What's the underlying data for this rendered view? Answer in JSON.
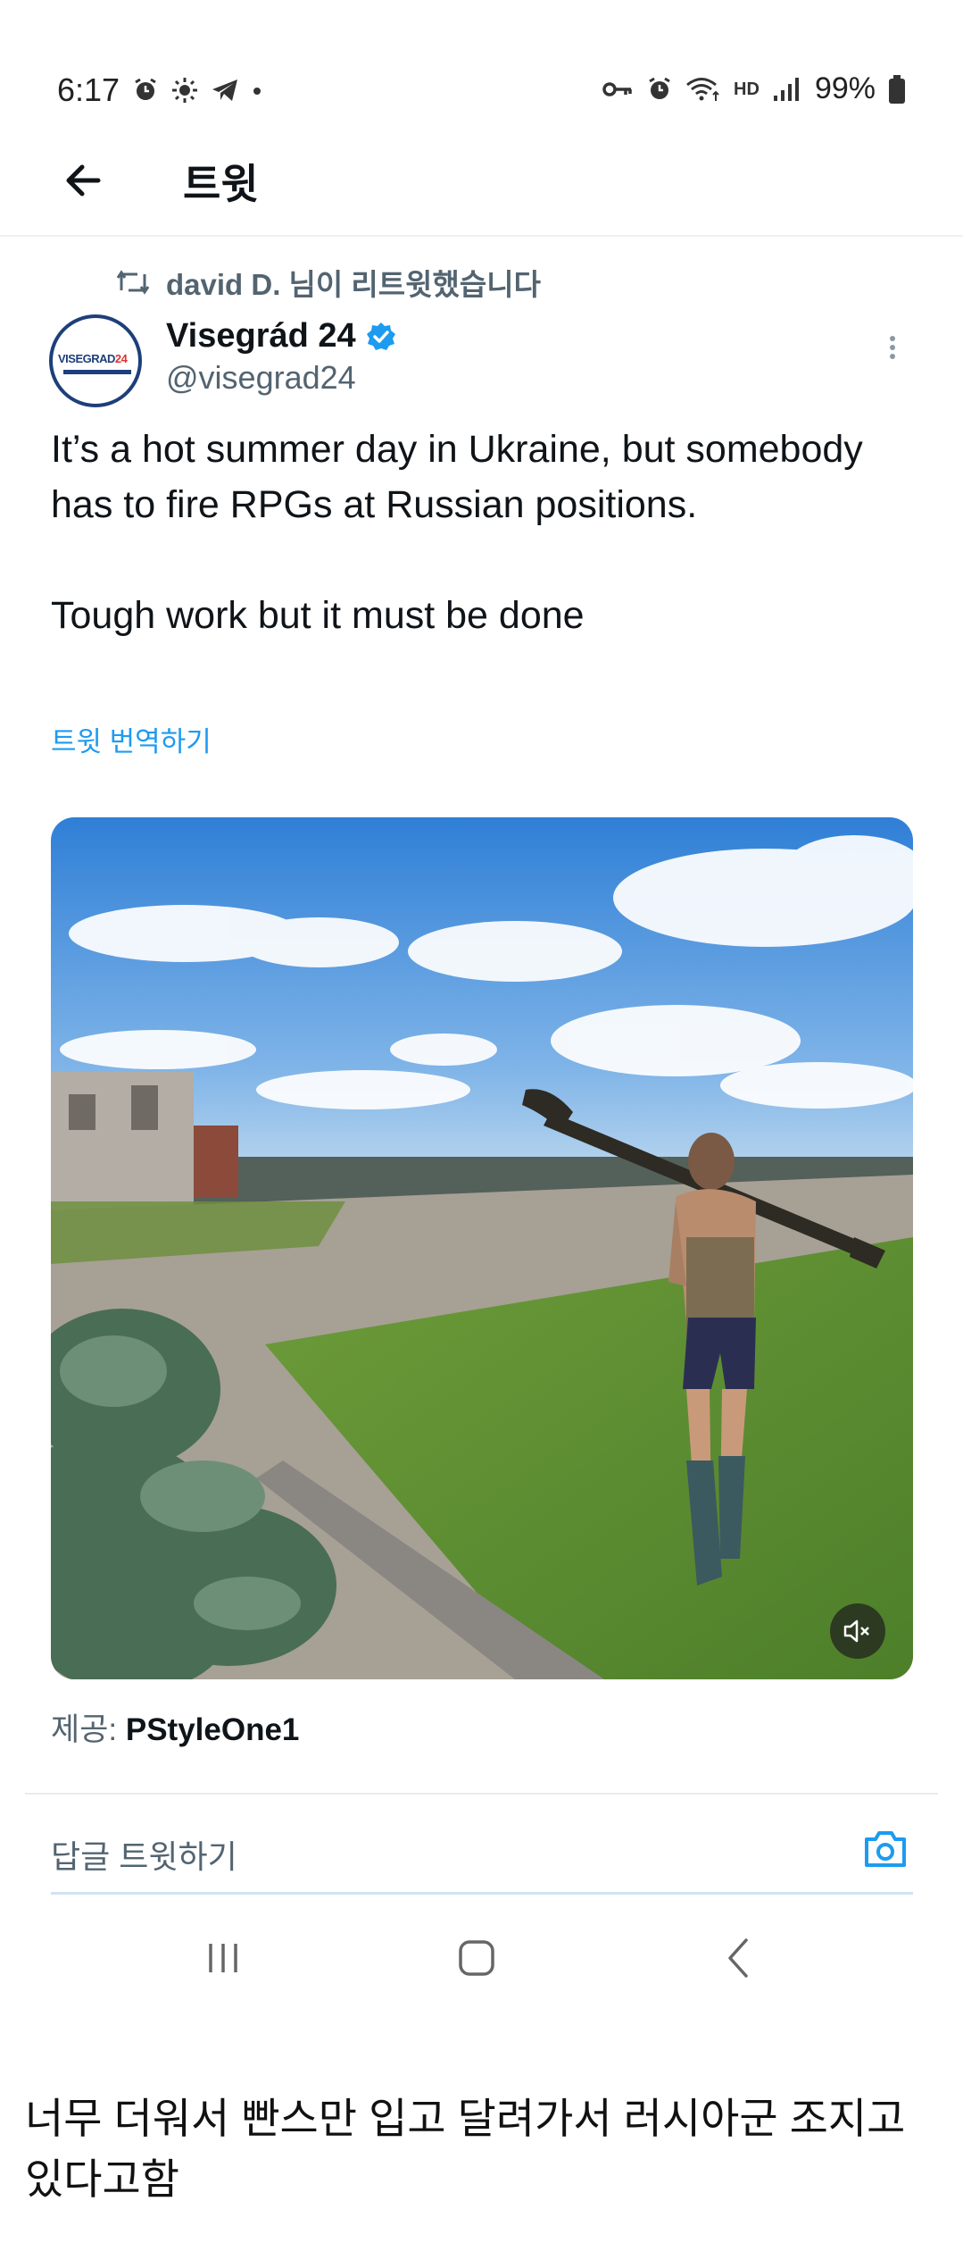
{
  "status_bar": {
    "time": "6:17",
    "network_label": "HD",
    "battery": "99%"
  },
  "header": {
    "title": "트윗"
  },
  "retweet": {
    "text": "david D. 님이 리트윗했습니다"
  },
  "author": {
    "name": "Visegrád 24",
    "handle": "@visegrad24",
    "avatar_logo_text": "VISEGRAD24",
    "verified": true
  },
  "tweet": {
    "text": "It’s a hot summer day in Ukraine, but somebody has to fire RPGs at Russian positions.\n\nTough work but it must be done",
    "translate_label": "트윗 번역하기"
  },
  "media": {
    "credit_prefix": "제공:",
    "credit_name": "PStyleOne1"
  },
  "reply": {
    "placeholder": "답글 트윗하기"
  },
  "caption": {
    "text": "너무 더워서 빤스만 입고 달려가서 러시아군 조지고 있다고함"
  },
  "colors": {
    "accent": "#1d9bf0",
    "secondary_text": "#536471",
    "primary_text": "#0f1419"
  },
  "icons": {
    "status_left": [
      "alarm-icon",
      "brightness-icon",
      "telegram-icon",
      "dot-icon"
    ],
    "status_right": [
      "vpn-key-icon",
      "alarm-icon",
      "wifi-icon",
      "signal-icon",
      "battery-icon"
    ]
  }
}
